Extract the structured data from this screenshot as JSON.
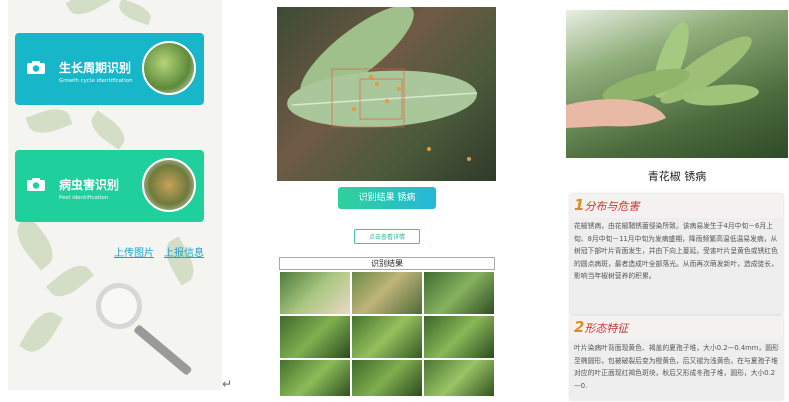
{
  "panel1": {
    "cards": [
      {
        "title": "生长周期识别",
        "subtitle": "Growth cycle identification",
        "color": "#17b6c9"
      },
      {
        "title": "病虫害识别",
        "subtitle": "Pest identification",
        "color": "#1fcf9c"
      }
    ],
    "links": {
      "upload": "上传图片",
      "info": "上报信息"
    }
  },
  "panel2": {
    "result_button": "识别结果 锈病",
    "detail_button": "点击查看详情",
    "results_header": "识别结果"
  },
  "panel3": {
    "title": "青花椒 锈病",
    "sections": [
      {
        "num": "1",
        "heading": "分布与危害",
        "body": "花椒锈病，由花椒鞘锈菌侵染所致。该病易发生于4月中旬－6月上旬、8月中旬－11月中旬为发病盛期，降雨频繁高温低温易发病，从树冠下部叶片背面发生，并由下向上蔓延。受害叶片呈黄色或锈红色的圆点病斑，最者造成叶全部落光。从而再次萌发新叶，造成徒长，影响当年椒树营养的积累。"
      },
      {
        "num": "2",
        "heading": "形态特征",
        "body": "叶片染病叶背面现黄色、褐盖的夏孢子堆，大小0.2—0.4mm，圆形至椭圆形，包被破裂后变为橙黄色，后又褪为浅黄色，在与夏孢子堆对应的叶正面现红褐色斑块，秋后又形成冬孢子堆，圆形，大小0.2—0."
      }
    ]
  },
  "misc": {
    "enter_symbol": "↵"
  }
}
